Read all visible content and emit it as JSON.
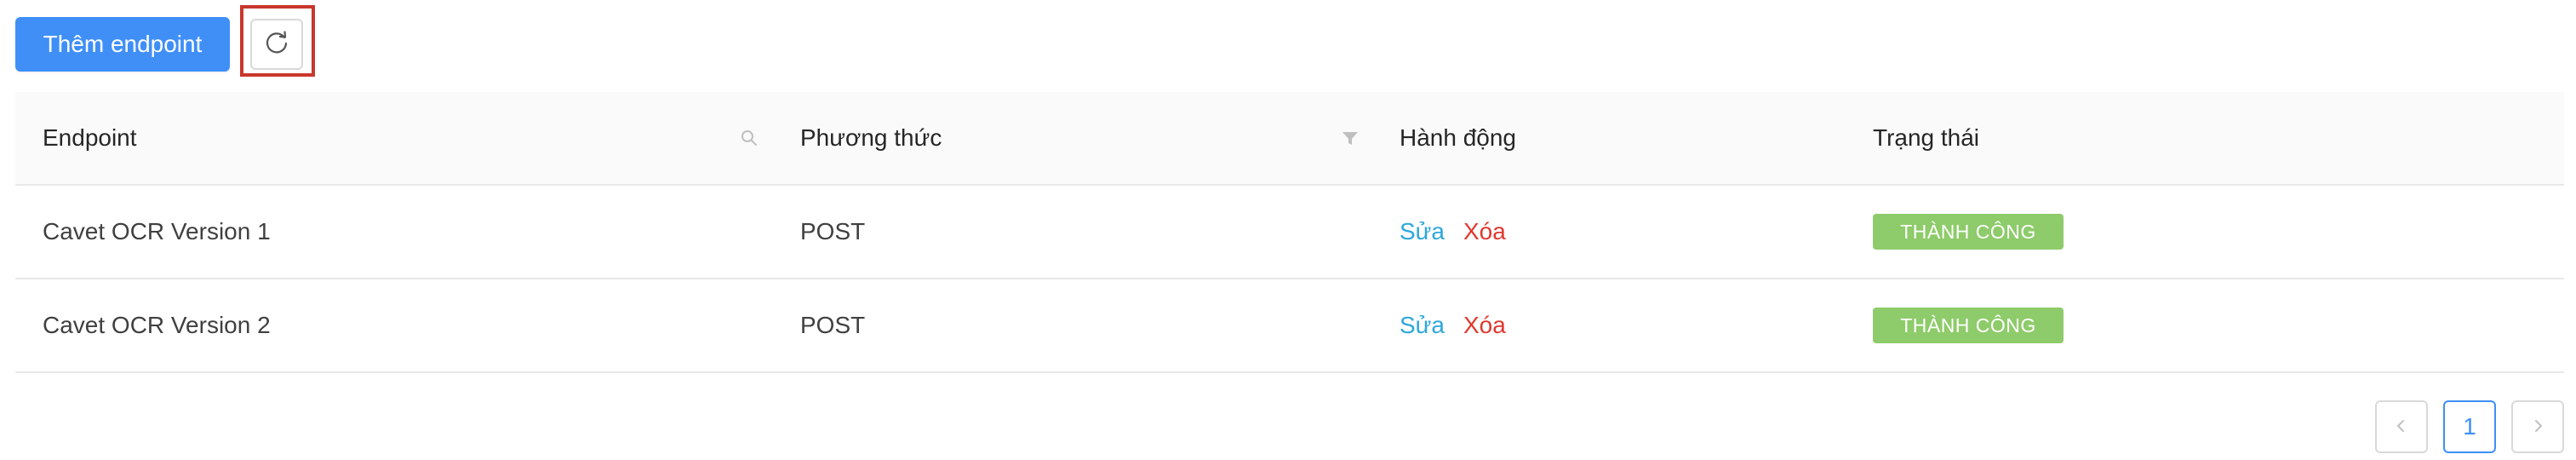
{
  "toolbar": {
    "add_label": "Thêm endpoint"
  },
  "table": {
    "columns": [
      {
        "label": "Endpoint"
      },
      {
        "label": "Phương thức"
      },
      {
        "label": "Hành động"
      },
      {
        "label": "Trạng thái"
      }
    ],
    "rows": [
      {
        "endpoint": "Cavet OCR Version 1",
        "method": "POST",
        "edit": "Sửa",
        "delete": "Xóa",
        "status": "THÀNH CÔNG"
      },
      {
        "endpoint": "Cavet OCR Version 2",
        "method": "POST",
        "edit": "Sửa",
        "delete": "Xóa",
        "status": "THÀNH CÔNG"
      }
    ]
  },
  "pagination": {
    "current_page": "1",
    "prev_icon": "chevron-left-icon",
    "next_icon": "chevron-right-icon"
  },
  "icons": {
    "refresh": "refresh-icon",
    "search": "search-icon",
    "filter": "filter-icon"
  },
  "colors": {
    "primary": "#3f8ff7",
    "edit_link": "#2ea7db",
    "delete_link": "#e0382e",
    "status_success": "#8ecb6a",
    "highlight": "#c9372c"
  }
}
